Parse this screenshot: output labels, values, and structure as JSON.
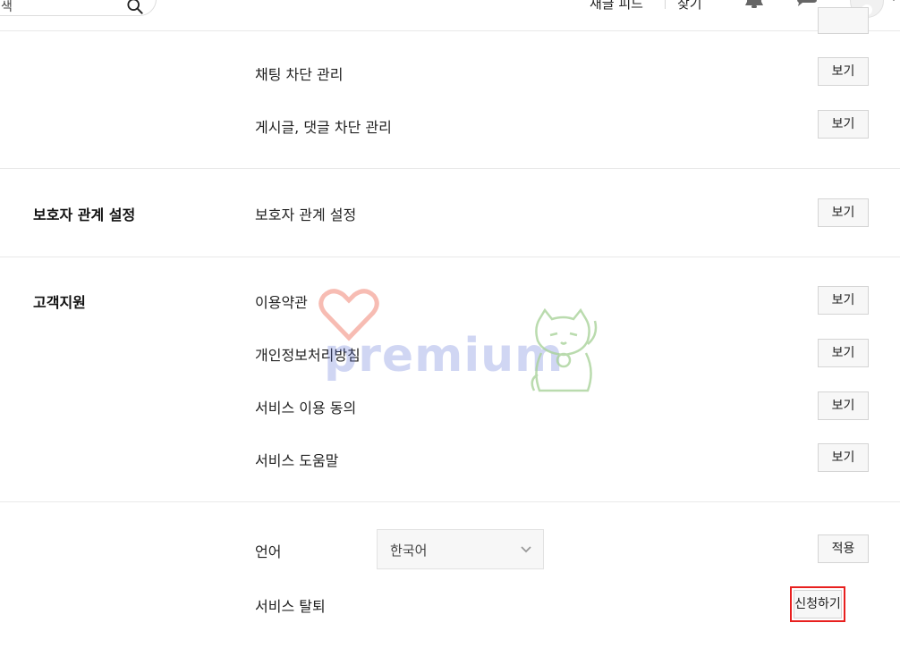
{
  "header": {
    "search_text": "색",
    "nav": [
      "새글 피드",
      "찾기"
    ]
  },
  "rows_top": [
    {
      "label": "채팅 차단 관리",
      "button": "보기"
    },
    {
      "label": "게시글, 댓글 차단 관리",
      "button": "보기"
    }
  ],
  "guardian": {
    "title": "보호자 관계 설정",
    "label": "보호자 관계 설정",
    "button": "보기"
  },
  "support": {
    "title": "고객지원",
    "items": [
      {
        "label": "이용약관",
        "button": "보기"
      },
      {
        "label": "개인정보처리방침",
        "button": "보기"
      },
      {
        "label": "서비스 이용 동의",
        "button": "보기"
      },
      {
        "label": "서비스 도움말",
        "button": "보기"
      }
    ]
  },
  "language": {
    "label": "언어",
    "selected": "한국어",
    "apply_button": "적용"
  },
  "withdraw": {
    "label": "서비스 탈퇴",
    "button": "신청하기"
  },
  "watermark": {
    "text": "premium"
  },
  "colors": {
    "highlight": "#e8201f",
    "watermark_blue": "#5b6fd6",
    "watermark_heart": "#f3a093",
    "watermark_cat": "#a9d39a"
  }
}
